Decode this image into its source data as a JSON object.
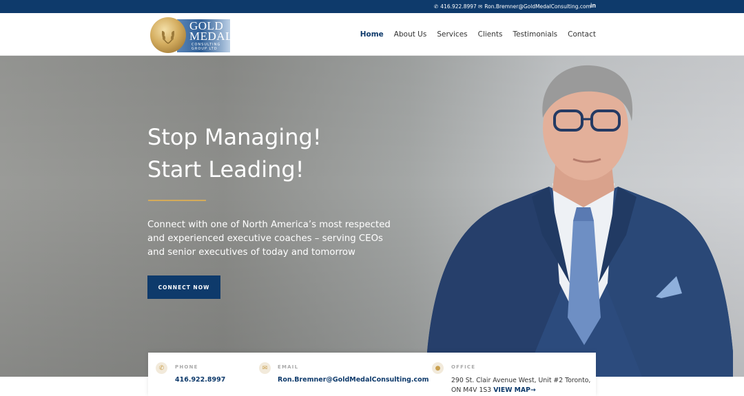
{
  "topbar": {
    "phone": "416.922.8997",
    "email": "Ron.Bremner@GoldMedalConsulting.com",
    "linkedin": "in"
  },
  "logo": {
    "line1": "GOLD",
    "line2": "MEDAL",
    "line3": "CONSULTING",
    "line4": "GROUP LTD"
  },
  "nav": {
    "items": [
      "Home",
      "About Us",
      "Services",
      "Clients",
      "Testimonials",
      "Contact"
    ],
    "active": "Home"
  },
  "hero": {
    "headline_1": "Stop Managing!",
    "headline_2": "Start Leading!",
    "subtext": "Connect with one of North America’s most respected and experienced executive coaches – serving CEOs and senior executives of today and tomorrow",
    "cta": "CONNECT NOW"
  },
  "contact": {
    "phone_label": "PHONE",
    "phone_value": "416.922.8997",
    "email_label": "EMAIL",
    "email_value": "Ron.Bremner@GoldMedalConsulting.com",
    "office_label": "OFFICE",
    "office_address": "290 St. Clair Avenue West, Unit #2 Toronto, ON M4V 1S3",
    "office_link": "VIEW MAP→"
  },
  "colors": {
    "brand_navy": "#0e3a6b",
    "accent_gold": "#d4ab5a"
  }
}
